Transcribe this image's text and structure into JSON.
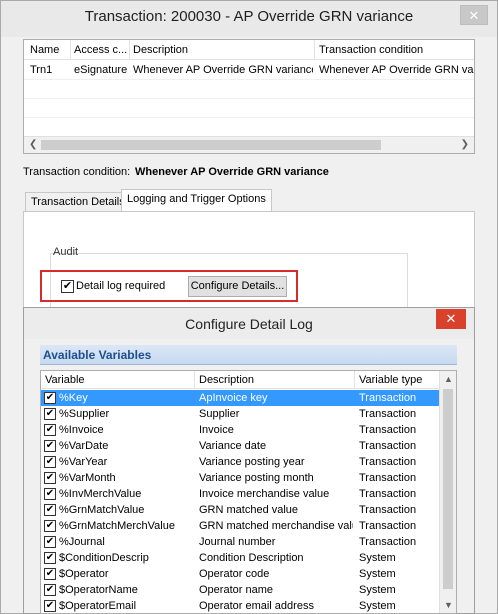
{
  "window": {
    "title": "Transaction: 200030 - AP Override GRN variance",
    "close_glyph": "✕"
  },
  "transactions_grid": {
    "columns": [
      "Name",
      "Access c...",
      "Description",
      "Transaction condition"
    ],
    "rows": [
      {
        "name": "Trn1",
        "access": "eSignature",
        "description": "Whenever AP Override GRN variance",
        "condition": "Whenever AP Override GRN variance"
      }
    ]
  },
  "transaction_condition": {
    "label": "Transaction condition:",
    "value": "Whenever AP Override GRN variance"
  },
  "tabs": [
    {
      "label": "Transaction Details",
      "active": false
    },
    {
      "label": "Logging and Trigger Options",
      "active": true
    }
  ],
  "audit": {
    "legend": "Audit",
    "detail_log_label": "Detail log required",
    "detail_log_checked": true,
    "configure_button": "Configure Details..."
  },
  "dialog": {
    "title": "Configure Detail Log",
    "close_glyph": "✕",
    "section_title": "Available Variables",
    "columns": [
      "Variable",
      "Description",
      "Variable type"
    ],
    "variables": [
      {
        "variable": "%Key",
        "description": "ApInvoice key",
        "type": "Transaction",
        "checked": true,
        "selected": true
      },
      {
        "variable": "%Supplier",
        "description": "Supplier",
        "type": "Transaction",
        "checked": true,
        "selected": false
      },
      {
        "variable": "%Invoice",
        "description": "Invoice",
        "type": "Transaction",
        "checked": true,
        "selected": false
      },
      {
        "variable": "%VarDate",
        "description": "Variance date",
        "type": "Transaction",
        "checked": true,
        "selected": false
      },
      {
        "variable": "%VarYear",
        "description": "Variance posting year",
        "type": "Transaction",
        "checked": true,
        "selected": false
      },
      {
        "variable": "%VarMonth",
        "description": "Variance posting month",
        "type": "Transaction",
        "checked": true,
        "selected": false
      },
      {
        "variable": "%InvMerchValue",
        "description": "Invoice merchandise value",
        "type": "Transaction",
        "checked": true,
        "selected": false
      },
      {
        "variable": "%GrnMatchValue",
        "description": "GRN matched value",
        "type": "Transaction",
        "checked": true,
        "selected": false
      },
      {
        "variable": "%GrnMatchMerchValue",
        "description": "GRN matched merchandise value",
        "type": "Transaction",
        "checked": true,
        "selected": false
      },
      {
        "variable": "%Journal",
        "description": "Journal number",
        "type": "Transaction",
        "checked": true,
        "selected": false
      },
      {
        "variable": "$ConditionDescrip",
        "description": "Condition Description",
        "type": "System",
        "checked": true,
        "selected": false
      },
      {
        "variable": "$Operator",
        "description": "Operator code",
        "type": "System",
        "checked": true,
        "selected": false
      },
      {
        "variable": "$OperatorName",
        "description": "Operator name",
        "type": "System",
        "checked": true,
        "selected": false
      },
      {
        "variable": "$OperatorEmail",
        "description": "Operator email address",
        "type": "System",
        "checked": true,
        "selected": false
      }
    ]
  }
}
